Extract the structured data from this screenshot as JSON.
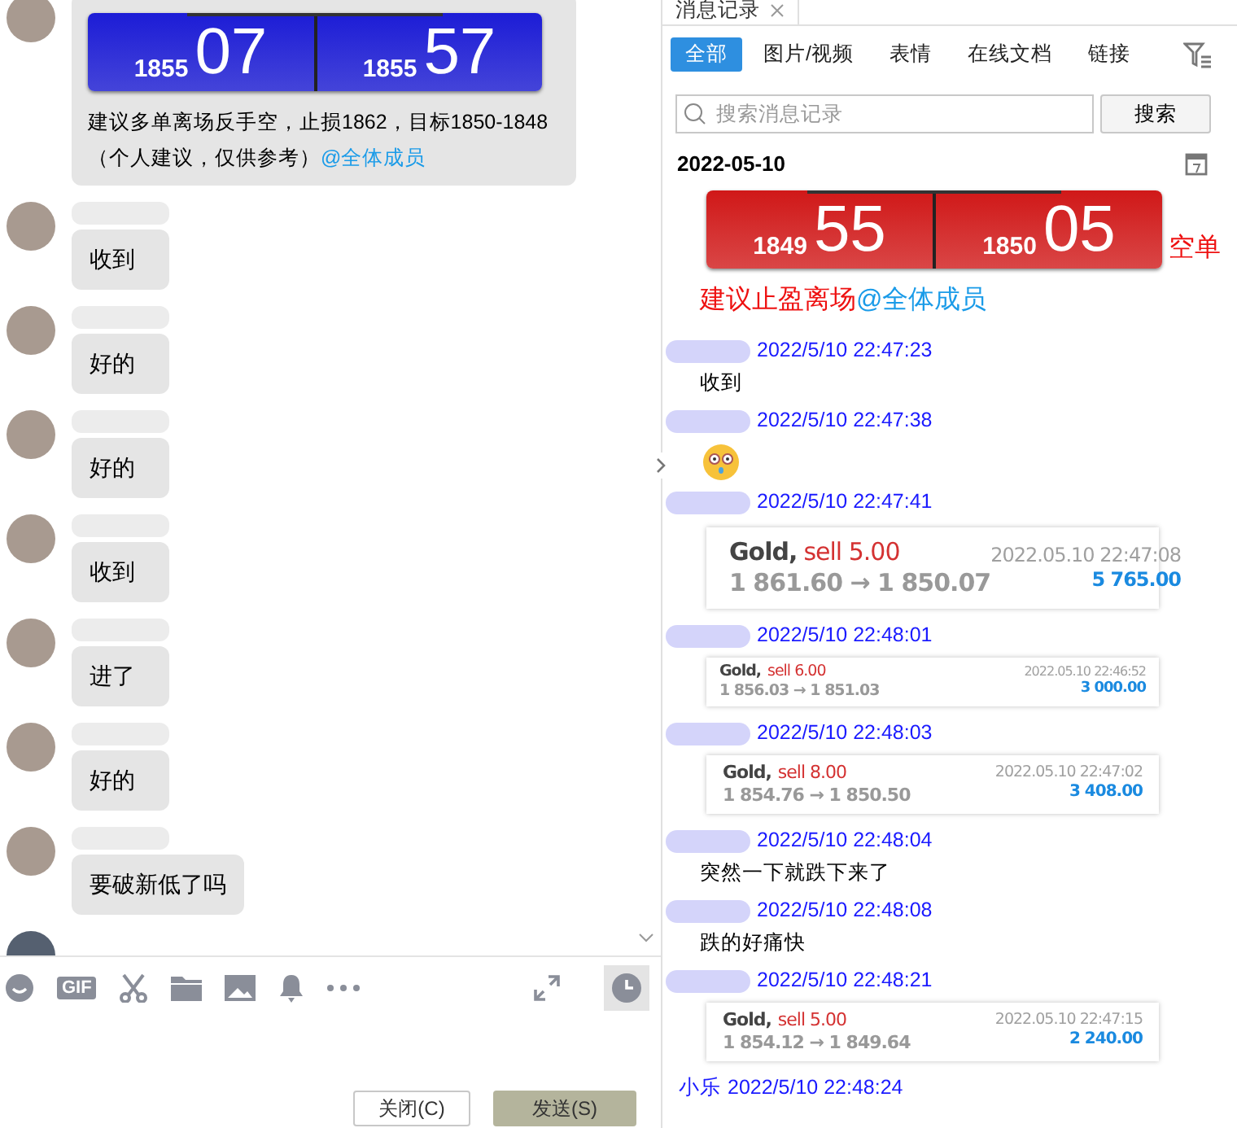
{
  "chat": {
    "messages": [
      {
        "kind": "board",
        "board": {
          "color": "#1c1cd6",
          "left_small": "1855",
          "left_big": "07",
          "right_small": "1855",
          "right_big": "57"
        },
        "text": "建议多单离场反手空，止损1862，目标1850-1848",
        "note": "（个人建议，仅供参考）",
        "mention": "@全体成员"
      },
      {
        "kind": "text",
        "text": "收到"
      },
      {
        "kind": "text",
        "text": "好的"
      },
      {
        "kind": "text",
        "text": "好的"
      },
      {
        "kind": "text",
        "text": "收到"
      },
      {
        "kind": "text",
        "text": "进了"
      },
      {
        "kind": "text",
        "text": "好的"
      },
      {
        "kind": "text",
        "text": "要破新低了吗"
      }
    ]
  },
  "composer": {
    "gif_label": "GIF",
    "buttons": [
      {
        "label": "关闭(C)",
        "kind": "close"
      },
      {
        "label": "发送(S)",
        "kind": "send"
      }
    ]
  },
  "history": {
    "tab": "消息记录",
    "filters": [
      {
        "label": "全部",
        "selected": true
      },
      {
        "label": "图片/视频",
        "selected": false
      },
      {
        "label": "表情",
        "selected": false
      },
      {
        "label": "在线文档",
        "selected": false
      },
      {
        "label": "链接",
        "selected": false
      }
    ],
    "search": {
      "placeholder": "搜索消息记录",
      "button": "搜索"
    },
    "date": "2022-05-10",
    "entries": [
      {
        "kind": "board",
        "board": {
          "color": "#d01818",
          "left_small": "1849",
          "left_big": "55",
          "right_small": "1850",
          "right_big": "05"
        },
        "side_label": "空单",
        "text": "建议止盈离场",
        "mention": "@全体成员"
      },
      {
        "kind": "text",
        "time": "2022/5/10 22:47:23",
        "text": "收到"
      },
      {
        "kind": "emoji",
        "time": "2022/5/10 22:47:38"
      },
      {
        "kind": "trade",
        "time": "2022/5/10 22:47:41",
        "trade": {
          "kind": "large",
          "symbol": "Gold,",
          "action": "sell 5.00",
          "stamp": "2022.05.10 22:47:08",
          "prices": "1 861.60 → 1 850.07",
          "profit": "5 765.00"
        }
      },
      {
        "kind": "trade",
        "time": "2022/5/10 22:48:01",
        "trade": {
          "kind": "small",
          "symbol": "Gold,",
          "action": "sell 6.00",
          "stamp": "2022.05.10 22:46:52",
          "prices": "1 856.03 → 1 851.03",
          "profit": "3 000.00"
        }
      },
      {
        "kind": "trade",
        "time": "2022/5/10 22:48:03",
        "trade": {
          "kind": "medium",
          "symbol": "Gold,",
          "action": "sell 8.00",
          "stamp": "2022.05.10 22:47:02",
          "prices": "1 854.76 → 1 850.50",
          "profit": "3 408.00"
        }
      },
      {
        "kind": "text",
        "time": "2022/5/10 22:48:04",
        "text": "突然一下就跌下来了"
      },
      {
        "kind": "text",
        "time": "2022/5/10 22:48:08",
        "text": "跌的好痛快"
      },
      {
        "kind": "trade",
        "time": "2022/5/10 22:48:21",
        "trade": {
          "kind": "medium",
          "symbol": "Gold,",
          "action": "sell 5.00",
          "stamp": "2022.05.10 22:47:15",
          "prices": "1 854.12 → 1 849.64",
          "profit": "2 240.00"
        }
      },
      {
        "kind": "named",
        "name": "小乐",
        "time": "2022/5/10 22:48:24"
      }
    ]
  }
}
